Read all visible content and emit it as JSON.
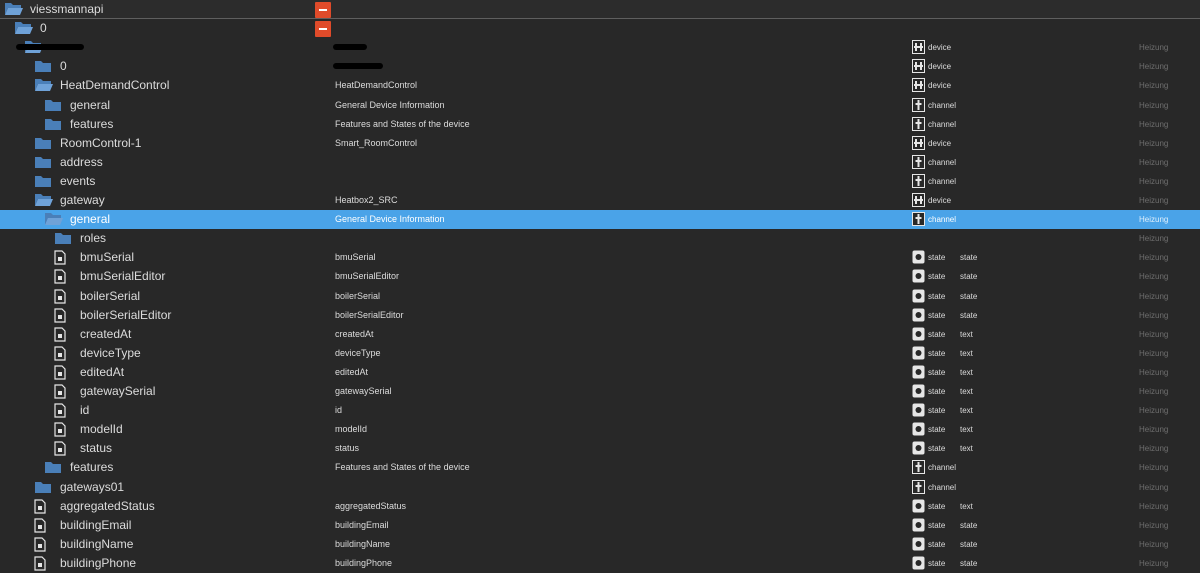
{
  "tree": {
    "rows": [
      {
        "id": "viessmannapi",
        "label": "viessmannapi",
        "depth": 0,
        "icon": "folder-open-icon",
        "name": "",
        "type": "",
        "role": "",
        "room": ""
      },
      {
        "id": "0-top",
        "label": "0",
        "depth": 1,
        "icon": "folder-open-icon",
        "name": "",
        "type": "",
        "role": "",
        "room": ""
      },
      {
        "id": "redacted-installation",
        "label": "",
        "depth": 2,
        "icon": "folder-open-icon",
        "name": "",
        "type": "device",
        "role": "",
        "room": "Heizung"
      },
      {
        "id": "0-gateway",
        "label": "0",
        "depth": 3,
        "icon": "folder-icon",
        "name": "",
        "type": "device",
        "role": "",
        "room": "Heizung"
      },
      {
        "id": "HeatDemandControl",
        "label": "HeatDemandControl",
        "depth": 3,
        "icon": "folder-open-icon",
        "name": "HeatDemandControl",
        "type": "device",
        "role": "",
        "room": "Heizung"
      },
      {
        "id": "hdc-general",
        "label": "general",
        "depth": 4,
        "icon": "folder-icon",
        "name": "General Device Information",
        "type": "channel",
        "role": "",
        "room": "Heizung"
      },
      {
        "id": "hdc-features",
        "label": "features",
        "depth": 4,
        "icon": "folder-icon",
        "name": "Features and States of the device",
        "type": "channel",
        "role": "",
        "room": "Heizung"
      },
      {
        "id": "RoomControl-1",
        "label": "RoomControl-1",
        "depth": 3,
        "icon": "folder-icon",
        "name": "Smart_RoomControl",
        "type": "device",
        "role": "",
        "room": "Heizung"
      },
      {
        "id": "address",
        "label": "address",
        "depth": 3,
        "icon": "folder-icon",
        "name": "",
        "type": "channel",
        "role": "",
        "room": "Heizung"
      },
      {
        "id": "events",
        "label": "events",
        "depth": 3,
        "icon": "folder-icon",
        "name": "",
        "type": "channel",
        "role": "",
        "room": "Heizung"
      },
      {
        "id": "gateway",
        "label": "gateway",
        "depth": 3,
        "icon": "folder-open-icon",
        "name": "Heatbox2_SRC",
        "type": "device",
        "role": "",
        "room": "Heizung"
      },
      {
        "id": "gw-general",
        "label": "general",
        "depth": 4,
        "icon": "folder-open-icon",
        "name": "General Device Information",
        "type": "channel",
        "role": "",
        "room": "Heizung",
        "selected": true
      },
      {
        "id": "roles",
        "label": "roles",
        "depth": 5,
        "icon": "folder-icon",
        "name": "",
        "type": "",
        "role": "",
        "room": "Heizung"
      },
      {
        "id": "bmuSerial",
        "label": "bmuSerial",
        "depth": 5,
        "icon": "file-icon",
        "name": "bmuSerial",
        "type": "state",
        "role": "state",
        "room": "Heizung"
      },
      {
        "id": "bmuSerialEditor",
        "label": "bmuSerialEditor",
        "depth": 5,
        "icon": "file-icon",
        "name": "bmuSerialEditor",
        "type": "state",
        "role": "state",
        "room": "Heizung"
      },
      {
        "id": "boilerSerial",
        "label": "boilerSerial",
        "depth": 5,
        "icon": "file-icon",
        "name": "boilerSerial",
        "type": "state",
        "role": "state",
        "room": "Heizung"
      },
      {
        "id": "boilerSerialEditor",
        "label": "boilerSerialEditor",
        "depth": 5,
        "icon": "file-icon",
        "name": "boilerSerialEditor",
        "type": "state",
        "role": "state",
        "room": "Heizung"
      },
      {
        "id": "createdAt",
        "label": "createdAt",
        "depth": 5,
        "icon": "file-icon",
        "name": "createdAt",
        "type": "state",
        "role": "text",
        "room": "Heizung"
      },
      {
        "id": "deviceType",
        "label": "deviceType",
        "depth": 5,
        "icon": "file-icon",
        "name": "deviceType",
        "type": "state",
        "role": "text",
        "room": "Heizung"
      },
      {
        "id": "editedAt",
        "label": "editedAt",
        "depth": 5,
        "icon": "file-icon",
        "name": "editedAt",
        "type": "state",
        "role": "text",
        "room": "Heizung"
      },
      {
        "id": "gatewaySerial",
        "label": "gatewaySerial",
        "depth": 5,
        "icon": "file-icon",
        "name": "gatewaySerial",
        "type": "state",
        "role": "text",
        "room": "Heizung"
      },
      {
        "id": "id",
        "label": "id",
        "depth": 5,
        "icon": "file-icon",
        "name": "id",
        "type": "state",
        "role": "text",
        "room": "Heizung"
      },
      {
        "id": "modelId",
        "label": "modelId",
        "depth": 5,
        "icon": "file-icon",
        "name": "modelId",
        "type": "state",
        "role": "text",
        "room": "Heizung"
      },
      {
        "id": "status",
        "label": "status",
        "depth": 5,
        "icon": "file-icon",
        "name": "status",
        "type": "state",
        "role": "text",
        "room": "Heizung"
      },
      {
        "id": "gw-features",
        "label": "features",
        "depth": 4,
        "icon": "folder-icon",
        "name": "Features and States of the device",
        "type": "channel",
        "role": "",
        "room": "Heizung"
      },
      {
        "id": "gateways01",
        "label": "gateways01",
        "depth": 3,
        "icon": "folder-icon",
        "name": "",
        "type": "channel",
        "role": "",
        "room": "Heizung"
      },
      {
        "id": "aggregatedStatus",
        "label": "aggregatedStatus",
        "depth": 3,
        "icon": "file-icon",
        "name": "aggregatedStatus",
        "type": "state",
        "role": "text",
        "room": "Heizung"
      },
      {
        "id": "buildingEmail",
        "label": "buildingEmail",
        "depth": 3,
        "icon": "file-icon",
        "name": "buildingEmail",
        "type": "state",
        "role": "state",
        "room": "Heizung"
      },
      {
        "id": "buildingName",
        "label": "buildingName",
        "depth": 3,
        "icon": "file-icon",
        "name": "buildingName",
        "type": "state",
        "role": "state",
        "room": "Heizung"
      },
      {
        "id": "buildingPhone",
        "label": "buildingPhone",
        "depth": 3,
        "icon": "file-icon",
        "name": "buildingPhone",
        "type": "state",
        "role": "state",
        "room": "Heizung"
      }
    ]
  },
  "colors": {
    "background": "#282828",
    "selected_row": "#4aa3e8",
    "folder": "#4a7fb8",
    "action_button": "#e04b2a",
    "room_text": "#6e6e6e"
  }
}
